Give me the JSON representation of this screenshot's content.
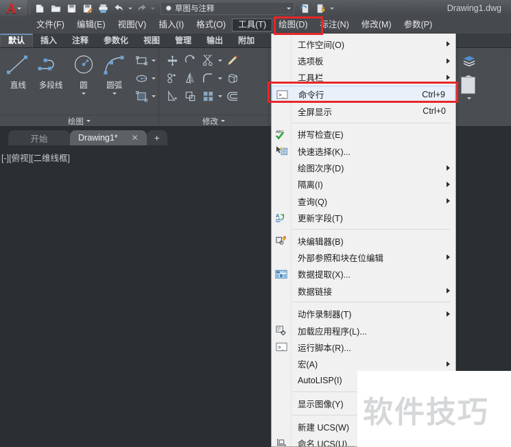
{
  "titlebar": {
    "app_logo": "autocad-logo",
    "workspace_label": "草图与注释",
    "document_title": "Drawing1.dwg",
    "quick_access": [
      {
        "name": "new-icon",
        "label": "新建"
      },
      {
        "name": "open-icon",
        "label": "打开"
      },
      {
        "name": "save-icon",
        "label": "保存"
      },
      {
        "name": "save-as-icon",
        "label": "另存为"
      },
      {
        "name": "plot-icon",
        "label": "打印"
      },
      {
        "name": "undo-icon",
        "label": "放弃"
      },
      {
        "name": "redo-icon",
        "label": "重做"
      }
    ],
    "right_icons": [
      {
        "name": "sync-settings-icon",
        "label": "同步设置"
      },
      {
        "name": "sign-in-icon",
        "label": "登录"
      },
      {
        "name": "help-menu-icon",
        "label": "帮助"
      }
    ]
  },
  "menubar": {
    "active": "工具(T)",
    "items": [
      {
        "label": "文件(F)",
        "name": "menu-file"
      },
      {
        "label": "编辑(E)",
        "name": "menu-edit"
      },
      {
        "label": "视图(V)",
        "name": "menu-view"
      },
      {
        "label": "插入(I)",
        "name": "menu-insert"
      },
      {
        "label": "格式(O)",
        "name": "menu-format"
      },
      {
        "label": "工具(T)",
        "name": "menu-tools"
      },
      {
        "label": "绘图(D)",
        "name": "menu-draw"
      },
      {
        "label": "标注(N)",
        "name": "menu-dimension"
      },
      {
        "label": "修改(M)",
        "name": "menu-modify"
      },
      {
        "label": "参数(P)",
        "name": "menu-parametric"
      }
    ]
  },
  "ribbon": {
    "selected_tab": "默认",
    "tabs": [
      {
        "label": "默认",
        "name": "ribbon-tab-home"
      },
      {
        "label": "插入",
        "name": "ribbon-tab-insert"
      },
      {
        "label": "注释",
        "name": "ribbon-tab-annotate"
      },
      {
        "label": "参数化",
        "name": "ribbon-tab-parametric"
      },
      {
        "label": "视图",
        "name": "ribbon-tab-view"
      },
      {
        "label": "管理",
        "name": "ribbon-tab-manage"
      },
      {
        "label": "输出",
        "name": "ribbon-tab-output"
      },
      {
        "label": "附加",
        "name": "ribbon-tab-addins"
      }
    ],
    "draw_panel": {
      "title": "绘图",
      "big_tools": [
        {
          "label": "直线",
          "icon": "line-icon",
          "dropdown": false
        },
        {
          "label": "多段线",
          "icon": "polyline-icon",
          "dropdown": false
        },
        {
          "label": "圆",
          "icon": "circle-icon",
          "dropdown": true
        },
        {
          "label": "圆弧",
          "icon": "arc-icon",
          "dropdown": true
        }
      ],
      "small_tools": [
        {
          "icon": "rectangle-icon",
          "dropdown": true
        },
        {
          "icon": "ellipse-icon",
          "dropdown": true
        },
        {
          "icon": "hatch-icon",
          "dropdown": true
        }
      ]
    },
    "modify_panel": {
      "title": "修改",
      "small_tools": [
        {
          "icon": "move-icon",
          "dropdown": false
        },
        {
          "icon": "rotate-icon",
          "dropdown": false
        },
        {
          "icon": "trim-icon",
          "dropdown": true
        },
        {
          "icon": "erase-icon",
          "dropdown": false
        },
        {
          "icon": "copy-icon",
          "dropdown": false
        },
        {
          "icon": "mirror-icon",
          "dropdown": false
        },
        {
          "icon": "fillet-icon",
          "dropdown": true
        },
        {
          "icon": "array-3d-icon",
          "dropdown": false
        },
        {
          "icon": "stretch-icon",
          "dropdown": false
        },
        {
          "icon": "scale-icon",
          "dropdown": false
        },
        {
          "icon": "array-icon",
          "dropdown": true
        },
        {
          "icon": "offset-icon",
          "dropdown": false
        }
      ]
    },
    "layer_panel": {
      "icons": [
        {
          "name": "layer-properties-icon"
        },
        {
          "name": "layer-state-icon"
        }
      ]
    }
  },
  "filetabs": {
    "items": [
      {
        "label": "开始",
        "name": "file-tab-start",
        "active": false,
        "closable": false
      },
      {
        "label": "Drawing1*",
        "name": "file-tab-drawing1",
        "active": true,
        "closable": true
      }
    ],
    "close_glyph": "✕",
    "new_tab_glyph": "+"
  },
  "canvas": {
    "viewport_label": "[-][俯视][二维线框]"
  },
  "dropdown_menu": {
    "owner": "工具(T)",
    "highlighted": "命令行",
    "items": [
      {
        "type": "item",
        "label": "工作空间(O)",
        "shortcut": "",
        "submenu": true,
        "icon": "",
        "name": "menu-item-workspace"
      },
      {
        "type": "item",
        "label": "选项板",
        "shortcut": "",
        "submenu": true,
        "icon": "",
        "name": "menu-item-palettes"
      },
      {
        "type": "item",
        "label": "工具栏",
        "shortcut": "",
        "submenu": true,
        "icon": "",
        "name": "menu-item-toolbars"
      },
      {
        "type": "item",
        "label": "命令行",
        "shortcut": "Ctrl+9",
        "submenu": false,
        "icon": "command-line-icon",
        "name": "menu-item-command-line",
        "highlight": true
      },
      {
        "type": "item",
        "label": "全屏显示",
        "shortcut": "Ctrl+0",
        "submenu": false,
        "icon": "",
        "name": "menu-item-clean-screen"
      },
      {
        "type": "sep"
      },
      {
        "type": "item",
        "label": "拼写检查(E)",
        "shortcut": "",
        "submenu": false,
        "icon": "spell-check-icon",
        "name": "menu-item-spell-check"
      },
      {
        "type": "item",
        "label": "快速选择(K)...",
        "shortcut": "",
        "submenu": false,
        "icon": "quick-select-icon",
        "name": "menu-item-quick-select"
      },
      {
        "type": "item",
        "label": "绘图次序(D)",
        "shortcut": "",
        "submenu": true,
        "icon": "",
        "name": "menu-item-draw-order"
      },
      {
        "type": "item",
        "label": "隔离(I)",
        "shortcut": "",
        "submenu": true,
        "icon": "",
        "name": "menu-item-isolate"
      },
      {
        "type": "item",
        "label": "查询(Q)",
        "shortcut": "",
        "submenu": true,
        "icon": "",
        "name": "menu-item-inquiry"
      },
      {
        "type": "item",
        "label": "更新字段(T)",
        "shortcut": "",
        "submenu": false,
        "icon": "update-fields-icon",
        "name": "menu-item-update-fields"
      },
      {
        "type": "sep"
      },
      {
        "type": "item",
        "label": "块编辑器(B)",
        "shortcut": "",
        "submenu": false,
        "icon": "block-editor-icon",
        "name": "menu-item-block-editor"
      },
      {
        "type": "item",
        "label": "外部参照和块在位编辑",
        "shortcut": "",
        "submenu": true,
        "icon": "",
        "name": "menu-item-xref-edit"
      },
      {
        "type": "item",
        "label": "数据提取(X)...",
        "shortcut": "",
        "submenu": false,
        "icon": "data-extraction-icon",
        "name": "menu-item-data-extraction"
      },
      {
        "type": "item",
        "label": "数据链接",
        "shortcut": "",
        "submenu": true,
        "icon": "",
        "name": "menu-item-data-links"
      },
      {
        "type": "sep"
      },
      {
        "type": "item",
        "label": "动作录制器(T)",
        "shortcut": "",
        "submenu": true,
        "icon": "",
        "name": "menu-item-action-recorder"
      },
      {
        "type": "item",
        "label": "加载应用程序(L)...",
        "shortcut": "",
        "submenu": false,
        "icon": "load-application-icon",
        "name": "menu-item-load-application"
      },
      {
        "type": "item",
        "label": "运行脚本(R)...",
        "shortcut": "",
        "submenu": false,
        "icon": "run-script-icon",
        "name": "menu-item-run-script"
      },
      {
        "type": "item",
        "label": "宏(A)",
        "shortcut": "",
        "submenu": true,
        "icon": "",
        "name": "menu-item-macro"
      },
      {
        "type": "item",
        "label": "AutoLISP(I)",
        "shortcut": "",
        "submenu": false,
        "icon": "",
        "name": "menu-item-autolisp"
      },
      {
        "type": "sep"
      },
      {
        "type": "item",
        "label": "显示图像(Y)",
        "shortcut": "",
        "submenu": false,
        "icon": "",
        "name": "menu-item-display-image"
      },
      {
        "type": "sep"
      },
      {
        "type": "item",
        "label": "新建 UCS(W)",
        "shortcut": "",
        "submenu": false,
        "icon": "",
        "name": "menu-item-new-ucs"
      },
      {
        "type": "item",
        "label": "命名 UCS(U)...",
        "shortcut": "",
        "submenu": false,
        "icon": "named-ucs-icon",
        "name": "menu-item-named-ucs"
      }
    ]
  },
  "annotations": {
    "boxes": [
      {
        "name": "highlight-box-tools-menu",
        "target": "工具(T)",
        "color": "#e8262a"
      },
      {
        "name": "highlight-box-command-line",
        "target": "命令行",
        "color": "#e8262a"
      }
    ]
  },
  "watermark": {
    "text": "软件技巧"
  },
  "colors": {
    "accent_red": "#e8262a",
    "ribbon_bg": "#4a4e52",
    "menu_bg": "#46494d",
    "canvas_bg": "#2b2f33",
    "dropdown_bg": "#f1f1f1",
    "dropdown_highlight": "#e9f0fa",
    "icon_blue": "#8cb4dc"
  }
}
